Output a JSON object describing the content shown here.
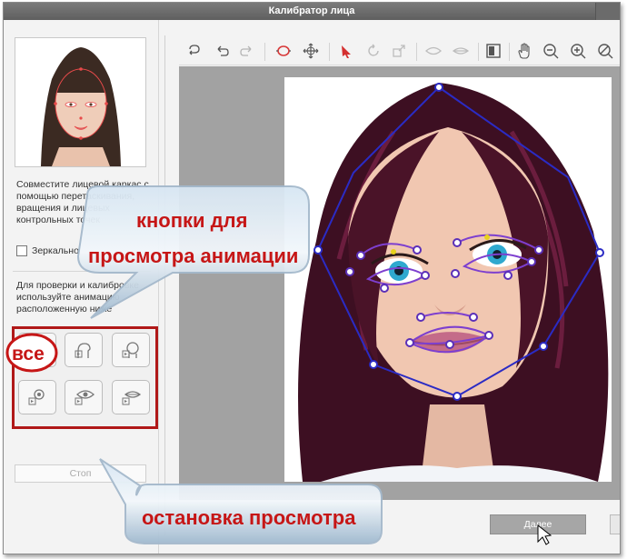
{
  "window": {
    "title": "Калибратор лица"
  },
  "left": {
    "instruction": "Совместите лицевой каркас с помощью перетаскивания, вращения и лицевых контрольных точек",
    "mirror_label": "Зеркально",
    "preview_instruction": "Для проверки и калибровке используйте анимацию расположенную ниже",
    "stop_label": "Стоп"
  },
  "footer": {
    "next_label": "Далее"
  },
  "annotations": {
    "callout_top_line1": "кнопки для",
    "callout_top_line2": "просмотра анимации",
    "callout_bottom": "остановка просмотра",
    "circle_label": "все"
  },
  "colors": {
    "accent_red": "#c61616",
    "mesh_line": "#2b2bc4",
    "mesh_feature": "#7d3fcf",
    "titlebar": "#6a6a6a"
  },
  "icons": [
    "redo-arrow-icon",
    "undo-icon",
    "redo-icon",
    "face-outline-icon",
    "fit-icon",
    "select-pointer-icon",
    "rotate-icon",
    "scale-icon",
    "eye-shape-icon",
    "lips-shape-icon",
    "compare-icon",
    "hand-pan-icon",
    "zoom-out-icon",
    "zoom-in-icon",
    "zoom-reset-icon"
  ]
}
